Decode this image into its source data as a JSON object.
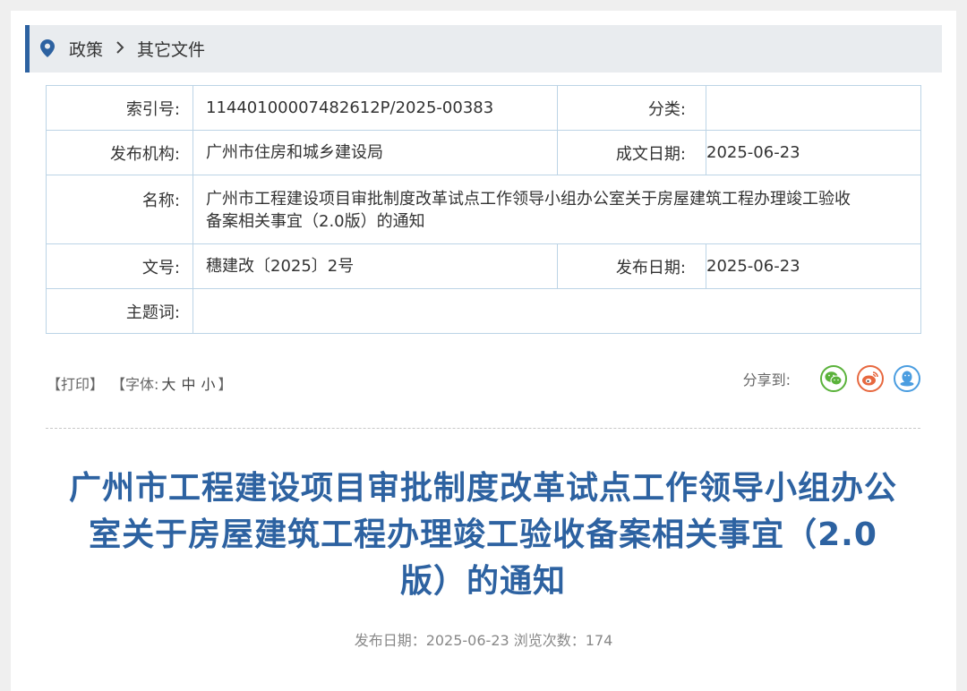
{
  "breadcrumb": {
    "items": [
      "政策",
      "其它文件"
    ],
    "separator": "›"
  },
  "meta": {
    "index_label": "索引号:",
    "index_value": "11440100007482612P/2025-00383",
    "category_label": "分类:",
    "category_value": "",
    "publisher_label": "发布机构:",
    "publisher_value": "广州市住房和城乡建设局",
    "created_label": "成文日期:",
    "created_value": "2025-06-23",
    "name_label": "名称:",
    "name_value_line1": "广州市工程建设项目审批制度改革试点工作领导小组办公室关于房屋建筑工程办理竣工验收",
    "name_value_line2": "备案相关事宜（2.0版）的通知",
    "docno_label": "文号:",
    "docno_value": "穗建改〔2025〕2号",
    "pubdate_label": "发布日期:",
    "pubdate_value": "2025-06-23",
    "keywords_label": "主题词:",
    "keywords_value": ""
  },
  "tools": {
    "print": "【打印】",
    "font_prefix": "【字体:",
    "font_large": "大",
    "font_medium": "中",
    "font_small": "小",
    "font_suffix": "】",
    "share_label": "分享到:",
    "share_icons": [
      "wechat-icon",
      "weibo-icon",
      "qq-icon"
    ]
  },
  "article": {
    "title_line1": "广州市工程建设项目审批制度改革试点工作领导小组办公",
    "title_line2": "室关于房屋建筑工程办理竣工验收备案相关事宜（2.0",
    "title_line3": "版）的通知",
    "pubinfo": "发布日期：2025-06-23   浏览次数：174"
  },
  "colors": {
    "accent": "#2d62a1",
    "table_border": "#bcd4e6",
    "wechat": "#5ab23a",
    "weibo": "#e7683f",
    "qq": "#4a9de0"
  }
}
